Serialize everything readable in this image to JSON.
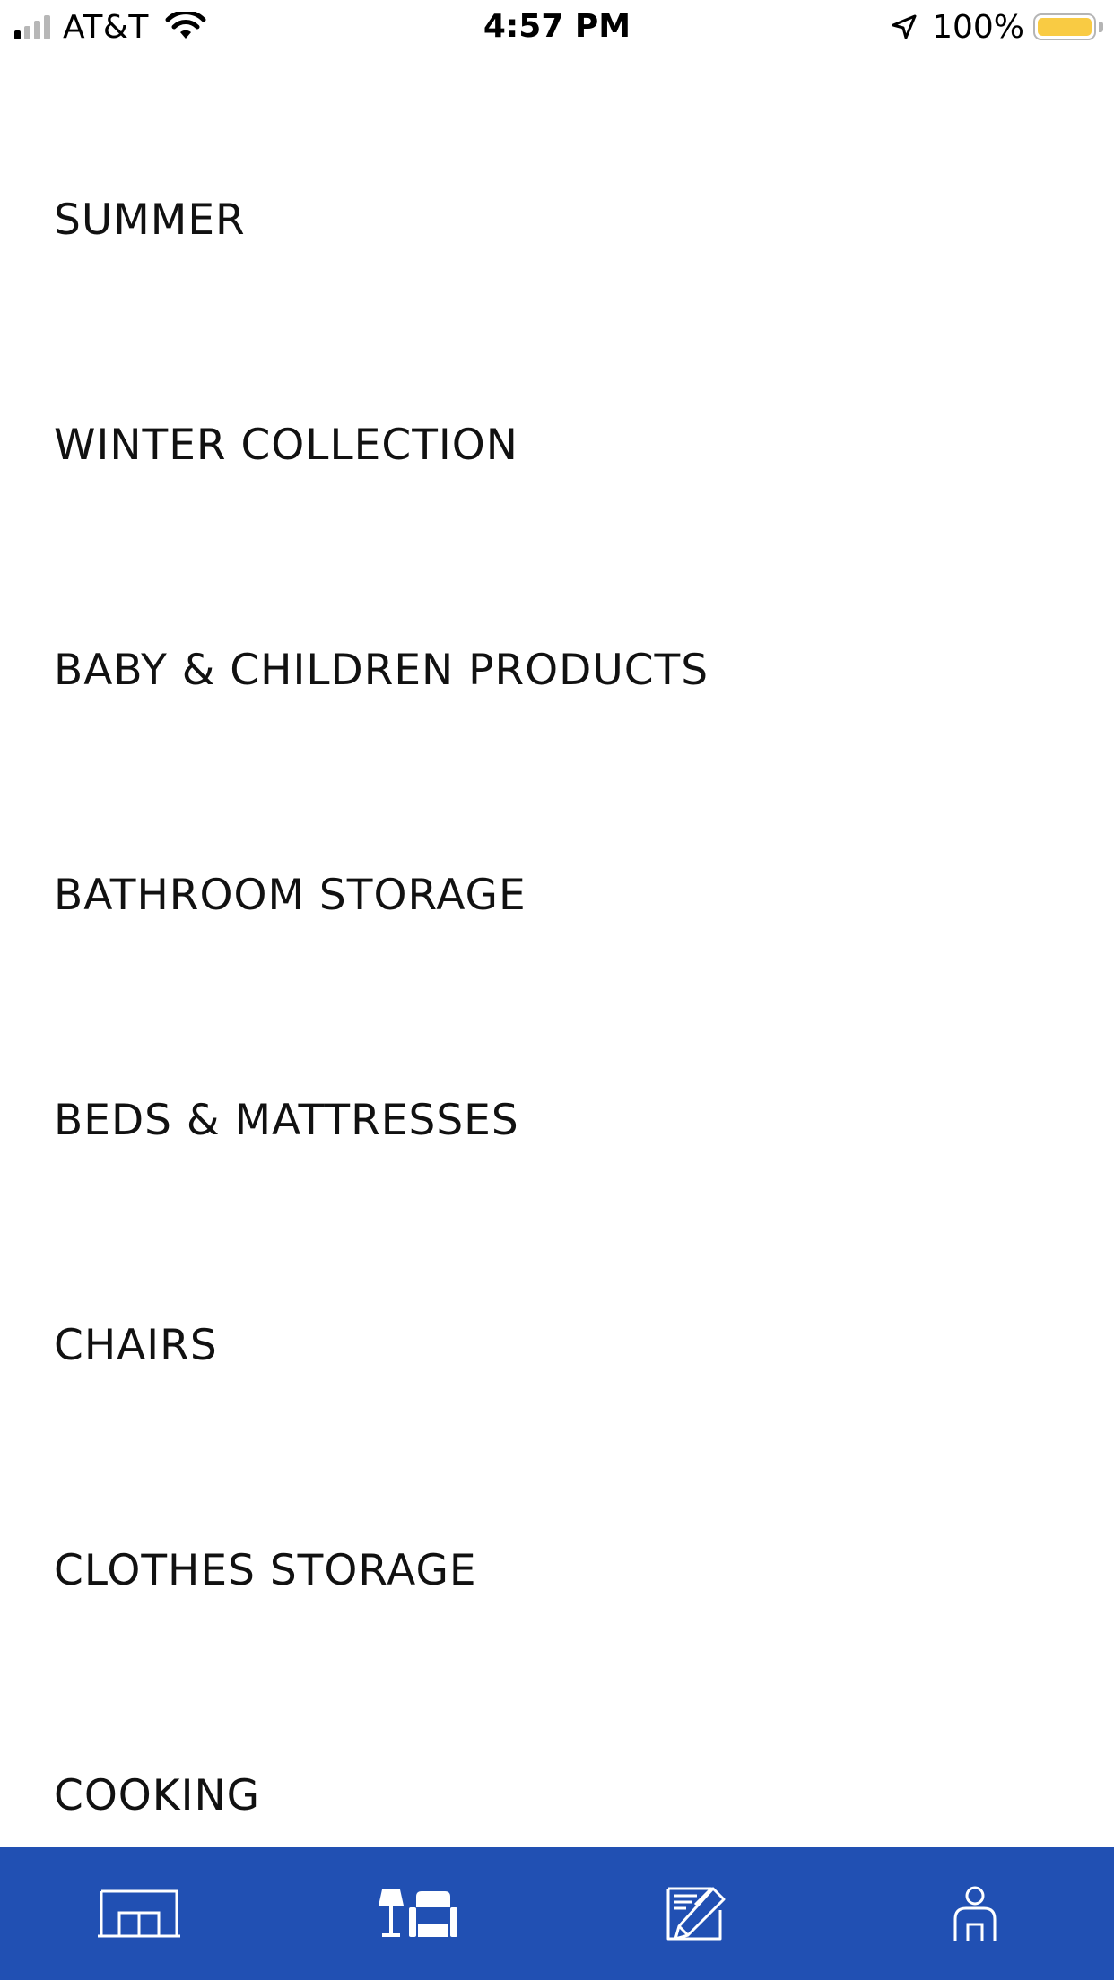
{
  "status_bar": {
    "carrier": "AT&T",
    "time": "4:57 PM",
    "battery_percent": "100%",
    "battery_color": "#F9CB43"
  },
  "categories": [
    {
      "label": "SUMMER"
    },
    {
      "label": "WINTER COLLECTION"
    },
    {
      "label": "BABY & CHILDREN PRODUCTS"
    },
    {
      "label": "BATHROOM STORAGE"
    },
    {
      "label": "BEDS & MATTRESSES"
    },
    {
      "label": "CHAIRS"
    },
    {
      "label": "CLOTHES STORAGE"
    },
    {
      "label": "COOKING"
    }
  ],
  "tab_bar": {
    "background": "#2150B3",
    "icon_color": "#ffffff",
    "tabs": [
      {
        "icon": "room-icon",
        "active": false
      },
      {
        "icon": "furniture-icon",
        "active": true
      },
      {
        "icon": "edit-list-icon",
        "active": false
      },
      {
        "icon": "profile-icon",
        "active": false
      }
    ]
  }
}
